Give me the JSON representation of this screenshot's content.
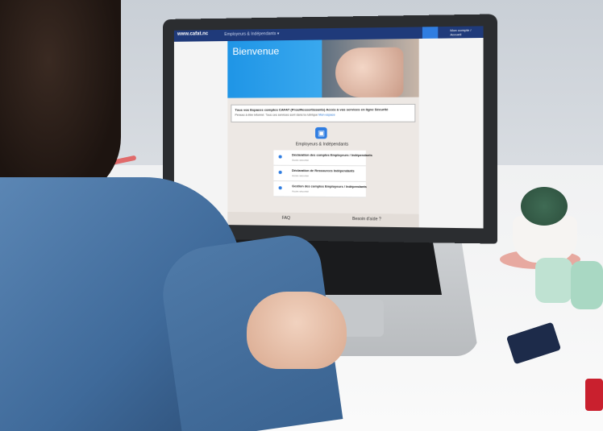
{
  "browser": {
    "logo_text": "www.cafat.nc",
    "breadcrumb": "Employeurs & Indépendants ▾",
    "user_label": "Mon compte / Accueil"
  },
  "hero": {
    "title": "Bienvenue"
  },
  "notice": {
    "line1": "Tous vos Espaces comptes CAFAT (Pros/Ressortissants) Accès à vos services en ligne Sécurité",
    "line2": "Pensez à être informé: Tous ces services sont dans la rubrique",
    "link": "Mon espace"
  },
  "section": {
    "title": "Employeurs & Indépendants"
  },
  "services": [
    {
      "label": "Déclaration des comptes Employeurs / Indépendants",
      "sub": "Accès sécurisé"
    },
    {
      "label": "Déclaration de Ressources Indépendants",
      "sub": "Accès sécurisé"
    },
    {
      "label": "Gestion des comptes Employeurs / Indépendants",
      "sub": "Accès sécurisé"
    }
  ],
  "footer": {
    "faq": "FAQ",
    "help": "Besoin d'aide ?"
  },
  "colors": {
    "brand_blue": "#2f7de1",
    "navbar": "#1f3a7a",
    "content_bg": "#ede8e4"
  },
  "icons": {
    "badge": "briefcase-icon",
    "home": "home-icon"
  }
}
